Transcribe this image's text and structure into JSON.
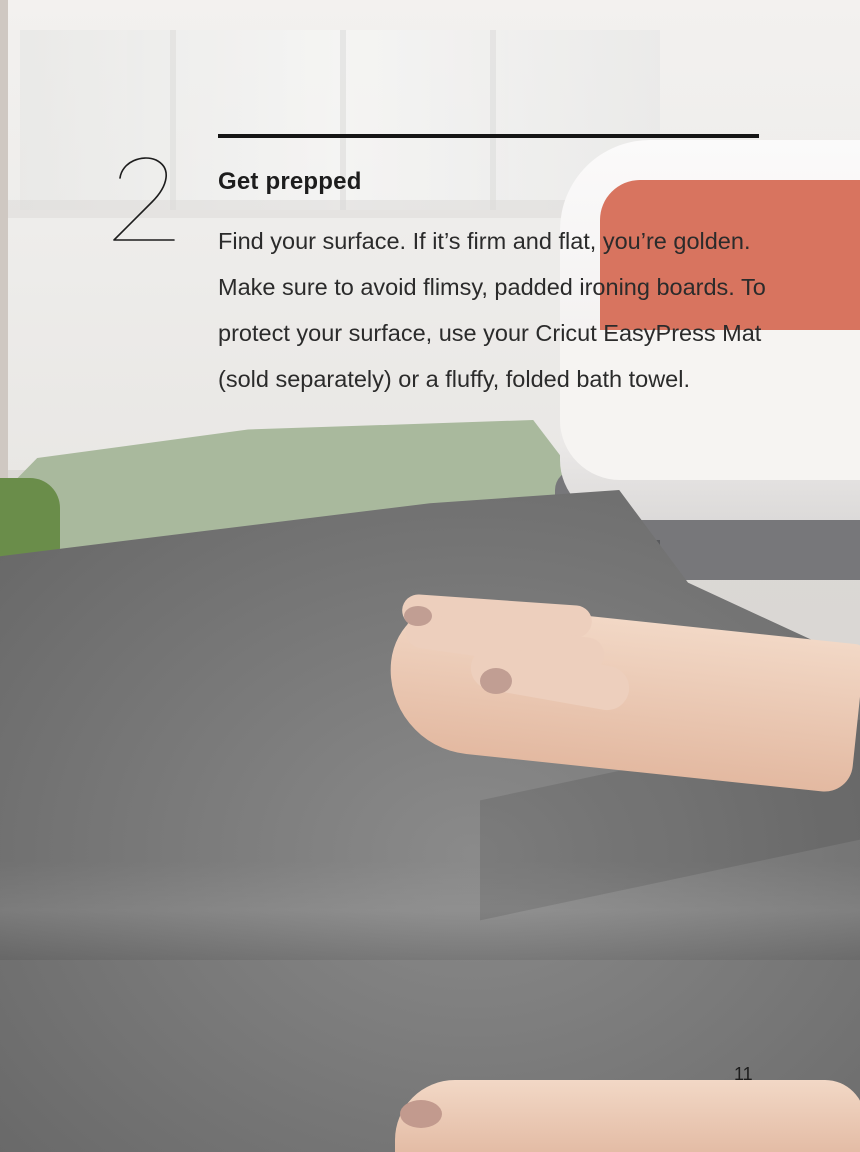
{
  "step": {
    "number": "2",
    "heading": "Get prepped",
    "body": "Find your surface. If it’s firm and flat, you’re golden. Make sure to avoid flimsy, padded ironing boards. To protect your surface, use your Cricut EasyPress Mat (sold separately) or a fluffy, folded bath towel."
  },
  "page": {
    "number": "11"
  },
  "colors": {
    "text": "#1d1d1d",
    "rule": "#151515",
    "press_accent": "#d8745f",
    "shirt_grey": "#7a7a7a",
    "shirt_green": "#a9b99d"
  }
}
